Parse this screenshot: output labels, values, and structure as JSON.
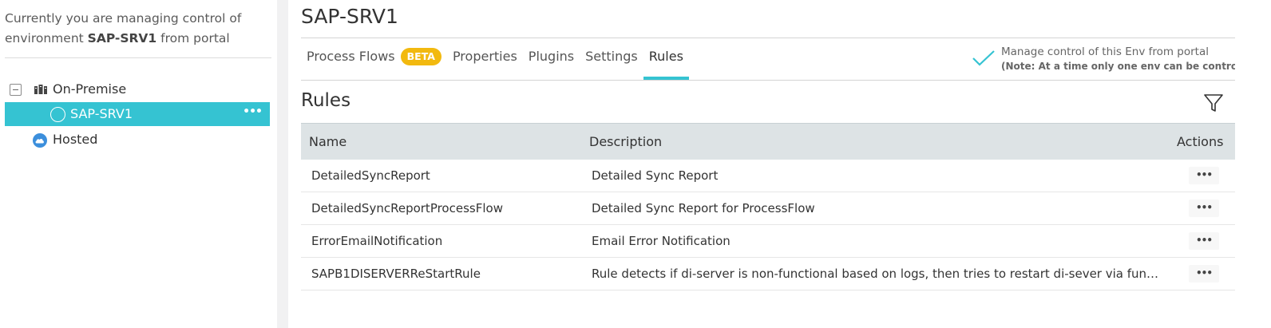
{
  "sidebar": {
    "intro_prefix": "Currently you are managing control of environment",
    "intro_env": "SAP-SRV1",
    "intro_suffix": "from portal",
    "tree": {
      "group_label": "On-Premise",
      "selected_label": "SAP-SRV1",
      "more_label": "•••",
      "hosted_label": "Hosted"
    }
  },
  "header": {
    "title": "SAP-SRV1"
  },
  "tabs": [
    {
      "label": "Process Flows",
      "badge": "BETA"
    },
    {
      "label": "Properties"
    },
    {
      "label": "Plugins"
    },
    {
      "label": "Settings"
    },
    {
      "label": "Rules",
      "active": true
    }
  ],
  "manage": {
    "label": "Manage control of this Env from portal",
    "note": "(Note: At a time only one env can be controlled)",
    "checked": true
  },
  "rules": {
    "heading": "Rules",
    "columns": {
      "name": "Name",
      "description": "Description",
      "actions": "Actions"
    },
    "rows": [
      {
        "name": "DetailedSyncReport",
        "description": "Detailed Sync Report",
        "actions": "•••"
      },
      {
        "name": "DetailedSyncReportProcessFlow",
        "description": "Detailed Sync Report for ProcessFlow",
        "actions": "•••"
      },
      {
        "name": "ErrorEmailNotification",
        "description": "Email Error Notification",
        "actions": "•••"
      },
      {
        "name": "SAPB1DISERVERReStartRule",
        "description": "Rule detects if di-server is non-functional based on logs, then tries to restart di-sever via functio...",
        "actions": "•••"
      }
    ]
  },
  "colors": {
    "accent": "#35c3d2",
    "beta_badge": "#f2b90f",
    "hosted_icon": "#3c8fdc",
    "table_header": "#dde3e5"
  },
  "icons": {
    "collapse": "collapse-minus-icon",
    "on_premise": "server-rack-icon",
    "environment": "circle-icon",
    "hosted": "cloud-icon",
    "manage": "checkmark-icon",
    "filter": "filter-icon",
    "actions": "more-dots-icon"
  }
}
